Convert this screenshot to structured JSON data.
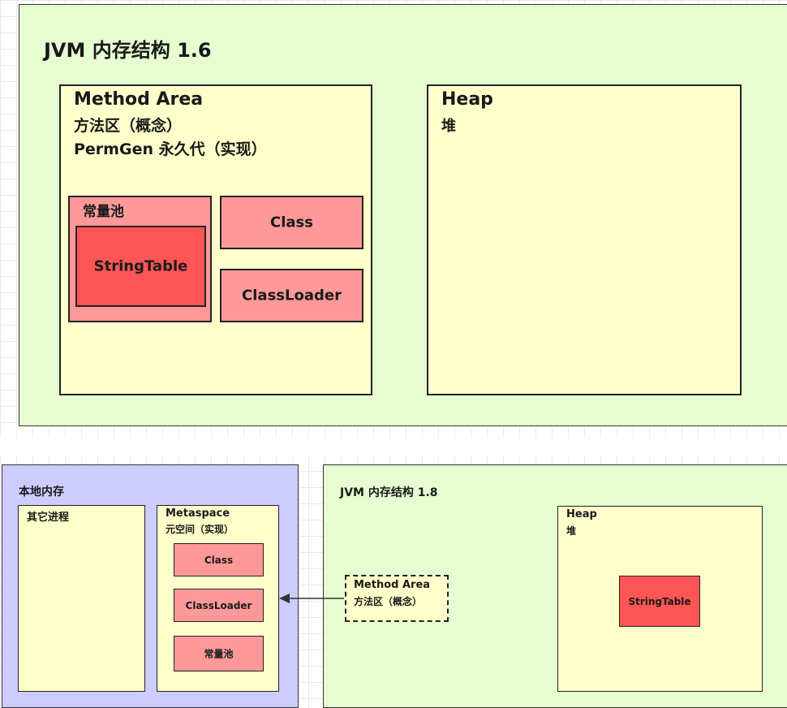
{
  "colors": {
    "jvm_bg": "#e6fdd2",
    "area_bg": "#fefecb",
    "pool_bg": "#ff9999",
    "string_table_bg": "#ff5555",
    "native_bg": "#ccccff",
    "border": "#222222"
  },
  "jvm16": {
    "title": "JVM 内存结构 1.6",
    "method_area": {
      "title": "Method Area",
      "line1": "方法区（概念）",
      "line2": "PermGen 永久代（实现）",
      "constant_pool": {
        "label": "常量池",
        "string_table": "StringTable"
      },
      "class": "Class",
      "classloader": "ClassLoader"
    },
    "heap": {
      "title": "Heap",
      "subtitle": "堆"
    }
  },
  "native_memory": {
    "title": "本地内存",
    "other_process": "其它进程",
    "metaspace": {
      "title": "Metaspace",
      "subtitle": "元空间（实现）",
      "class": "Class",
      "classloader": "ClassLoader",
      "constant_pool": "常量池"
    }
  },
  "jvm18": {
    "title": "JVM 内存结构 1.8",
    "method_area": {
      "title": "Method Area",
      "subtitle": "方法区（概念）"
    },
    "heap": {
      "title": "Heap",
      "subtitle": "堆",
      "string_table": "StringTable"
    }
  }
}
